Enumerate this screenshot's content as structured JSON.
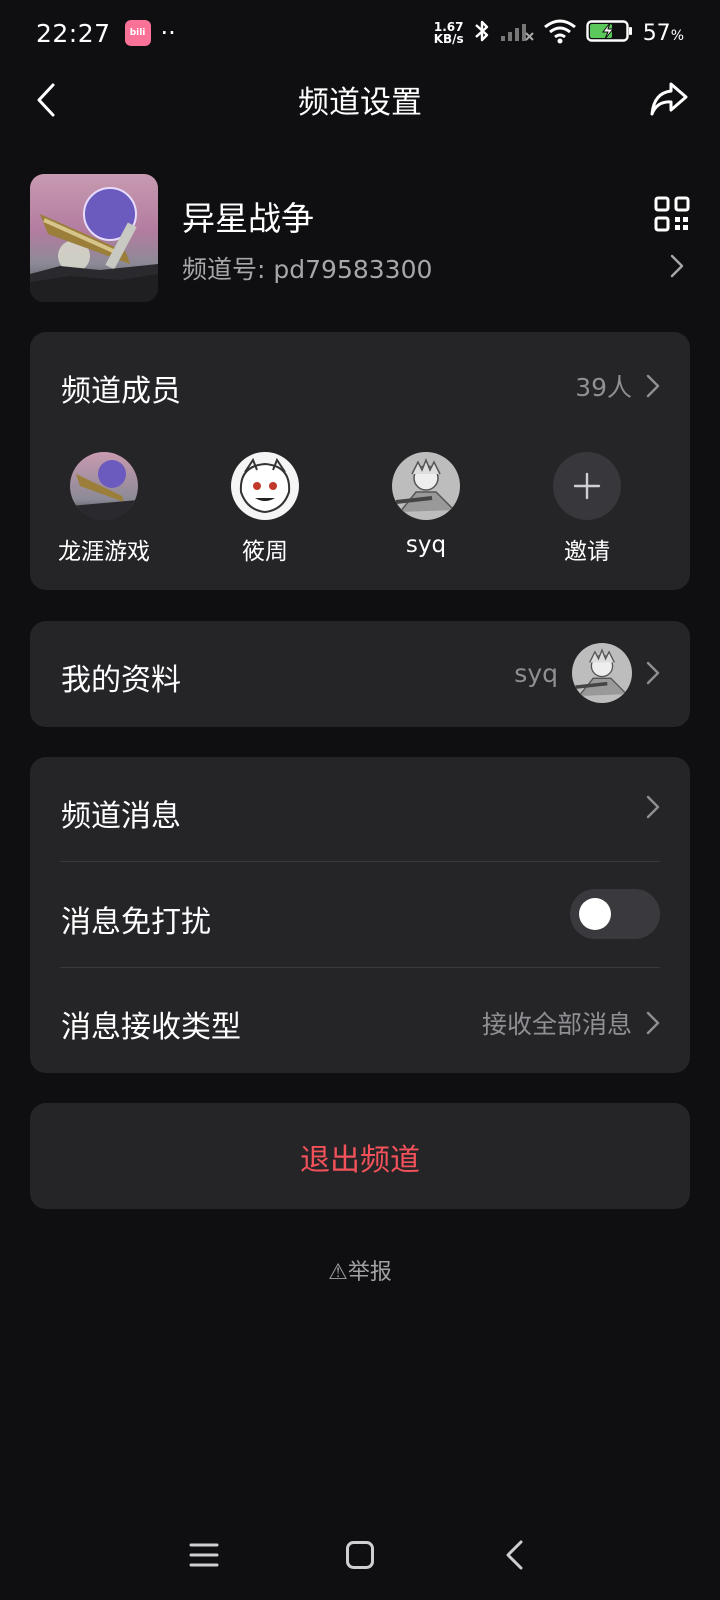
{
  "status_bar": {
    "time": "22:27",
    "app_badge": "bili",
    "dots": "··",
    "net_speed_value": "1.67",
    "net_speed_unit": "KB/s",
    "battery_percent": "57",
    "battery_symbol": "%",
    "icons": [
      "bluetooth-icon",
      "signal-icon",
      "wifi-icon",
      "battery-charging-icon"
    ]
  },
  "header": {
    "title": "频道设置",
    "back_icon": "chevron-left-icon",
    "share_icon": "share-icon"
  },
  "channel": {
    "name": "异星战争",
    "id_label": "频道号:",
    "id_value": "pd79583300",
    "qr_icon": "qr-code-icon"
  },
  "members": {
    "title": "频道成员",
    "count": "39人",
    "items": [
      {
        "name": "龙涯游戏"
      },
      {
        "name": "筱周"
      },
      {
        "name": "syq"
      },
      {
        "name": "邀请"
      }
    ]
  },
  "profile": {
    "title": "我的资料",
    "nickname": "syq"
  },
  "settings": {
    "channel_message": "频道消息",
    "dnd": "消息免打扰",
    "dnd_on": false,
    "receive_type": "消息接收类型",
    "receive_value": "接收全部消息"
  },
  "exit": {
    "label": "退出频道"
  },
  "report": {
    "icon": "⚠",
    "label": "举报"
  },
  "colors": {
    "background": "#0f0f11",
    "card": "#252528",
    "danger": "#f3525a",
    "muted": "#8f8f94",
    "brand": "#fb7299",
    "battery": "#5ac85a"
  }
}
